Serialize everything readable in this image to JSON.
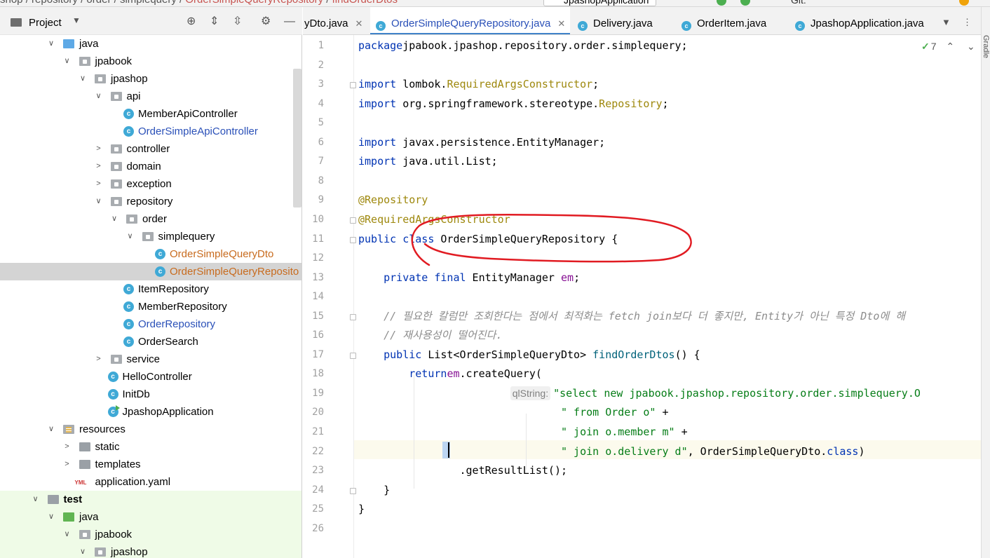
{
  "topbar": {
    "breadcrumb": [
      "shop",
      "repository",
      "order",
      "simplequery"
    ],
    "breadcrumb_class": "OrderSimpleQueryRepository",
    "breadcrumb_method": "findOrderDtos",
    "run_config": "JpashopApplication",
    "git_label": "Git:"
  },
  "project_panel": {
    "title": "Project",
    "toolbar_icons": [
      "locate-icon",
      "expand-all-icon",
      "collapse-all-icon",
      "gear-icon",
      "minimize-icon"
    ],
    "tree": [
      {
        "label": "java",
        "type": "src-folder",
        "indent": 0,
        "arrow": "open"
      },
      {
        "label": "jpabook",
        "type": "package",
        "indent": 1,
        "arrow": "open"
      },
      {
        "label": "jpashop",
        "type": "package",
        "indent": 2,
        "arrow": "open"
      },
      {
        "label": "api",
        "type": "package",
        "indent": 3,
        "arrow": "open"
      },
      {
        "label": "MemberApiController",
        "type": "class",
        "indent": 4,
        "arrow": "none",
        "style": "normal"
      },
      {
        "label": "OrderSimpleApiController",
        "type": "class",
        "indent": 4,
        "arrow": "none",
        "style": "blue"
      },
      {
        "label": "controller",
        "type": "package",
        "indent": 3,
        "arrow": "closed"
      },
      {
        "label": "domain",
        "type": "package",
        "indent": 3,
        "arrow": "closed"
      },
      {
        "label": "exception",
        "type": "package",
        "indent": 3,
        "arrow": "closed"
      },
      {
        "label": "repository",
        "type": "package",
        "indent": 3,
        "arrow": "open"
      },
      {
        "label": "order",
        "type": "package",
        "indent": 4,
        "arrow": "open"
      },
      {
        "label": "simplequery",
        "type": "package",
        "indent": 5,
        "arrow": "open"
      },
      {
        "label": "OrderSimpleQueryDto",
        "type": "class",
        "indent": 6,
        "arrow": "none",
        "style": "orange"
      },
      {
        "label": "OrderSimpleQueryReposito",
        "type": "class",
        "indent": 6,
        "arrow": "none",
        "style": "orange",
        "selected": true
      },
      {
        "label": "ItemRepository",
        "type": "class",
        "indent": 4,
        "arrow": "none",
        "style": "normal"
      },
      {
        "label": "MemberRepository",
        "type": "class",
        "indent": 4,
        "arrow": "none",
        "style": "normal"
      },
      {
        "label": "OrderRepository",
        "type": "class",
        "indent": 4,
        "arrow": "none",
        "style": "blue"
      },
      {
        "label": "OrderSearch",
        "type": "class",
        "indent": 4,
        "arrow": "none",
        "style": "normal"
      },
      {
        "label": "service",
        "type": "package",
        "indent": 3,
        "arrow": "closed"
      },
      {
        "label": "HelloController",
        "type": "class",
        "indent": 3,
        "arrow": "none",
        "style": "normal"
      },
      {
        "label": "InitDb",
        "type": "class",
        "indent": 3,
        "arrow": "none",
        "style": "normal"
      },
      {
        "label": "JpashopApplication",
        "type": "app-class",
        "indent": 3,
        "arrow": "none",
        "style": "normal"
      },
      {
        "label": "resources",
        "type": "res-folder",
        "indent": 0,
        "arrow": "open"
      },
      {
        "label": "static",
        "type": "gray-folder",
        "indent": 1,
        "arrow": "closed"
      },
      {
        "label": "templates",
        "type": "gray-folder",
        "indent": 1,
        "arrow": "closed"
      },
      {
        "label": "application.yaml",
        "type": "yaml",
        "indent": 1,
        "arrow": "none",
        "style": "normal"
      },
      {
        "label": "test",
        "type": "test-root",
        "indent": -1,
        "arrow": "open",
        "test": true
      },
      {
        "label": "java",
        "type": "test-folder",
        "indent": 0,
        "arrow": "open",
        "test": true
      },
      {
        "label": "jpabook",
        "type": "package",
        "indent": 1,
        "arrow": "open",
        "test": true
      },
      {
        "label": "jpashop",
        "type": "package",
        "indent": 2,
        "arrow": "open",
        "test": true
      }
    ]
  },
  "tabs": [
    {
      "label": "yDto.java",
      "close": "✕",
      "active": false,
      "icon": false
    },
    {
      "label": "OrderSimpleQueryRepository.java",
      "close": "✕",
      "active": true,
      "icon": true
    },
    {
      "label": "Delivery.java",
      "close": "",
      "active": false,
      "icon": true
    },
    {
      "label": "OrderItem.java",
      "close": "",
      "active": false,
      "icon": true
    },
    {
      "label": "JpashopApplication.java",
      "close": "",
      "active": false,
      "icon": true
    }
  ],
  "inspection": {
    "count": "7"
  },
  "right_strip_label": "Gradle",
  "code_lines": [
    [
      [
        "kw",
        "package"
      ],
      [
        "",
        "jpabook.jpashop.repository.order.simplequery;"
      ]
    ],
    [],
    [
      [
        "kw",
        "import"
      ],
      [
        "",
        " lombok."
      ],
      [
        "ann",
        "RequiredArgsConstructor"
      ],
      [
        "",
        ";"
      ]
    ],
    [
      [
        "kw",
        "import"
      ],
      [
        "",
        " org.springframework.stereotype."
      ],
      [
        "ann",
        "Repository"
      ],
      [
        "",
        ";"
      ]
    ],
    [],
    [
      [
        "kw",
        "import"
      ],
      [
        "",
        " javax.persistence.EntityManager;"
      ]
    ],
    [
      [
        "kw",
        "import"
      ],
      [
        "",
        " java.util.List;"
      ]
    ],
    [],
    [
      [
        "ann",
        "@Repository"
      ]
    ],
    [
      [
        "ann",
        "@RequiredArgsConstructor"
      ]
    ],
    [
      [
        "kw",
        "public class"
      ],
      [
        "",
        " OrderSimpleQueryRepository {"
      ]
    ],
    [],
    [
      [
        "",
        "    "
      ],
      [
        "kw",
        "private final"
      ],
      [
        "",
        " EntityManager "
      ],
      [
        "fld",
        "em"
      ],
      [
        "",
        ";"
      ]
    ],
    [],
    [
      [
        "cmt",
        "    // 필요한 칼럼만 조회한다는 점에서 최적화는 fetch join보다 더 좋지만, Entity가 아닌 특정 Dto에 해"
      ]
    ],
    [
      [
        "cmt",
        "    // 재사용성이 떨어진다."
      ]
    ],
    [
      [
        "",
        "    "
      ],
      [
        "kw",
        "public"
      ],
      [
        "",
        " List<OrderSimpleQueryDto> "
      ],
      [
        "fn",
        "findOrderDtos"
      ],
      [
        "",
        "() {"
      ]
    ],
    [
      [
        "",
        "        "
      ],
      [
        "kw",
        "return"
      ],
      [
        " ",
        ""
      ],
      [
        "fld",
        "em"
      ],
      [
        "",
        ".createQuery("
      ]
    ],
    [
      [
        "",
        "                        "
      ],
      [
        "hint",
        "qlString:"
      ],
      [
        "str",
        "\"select new jpabook.jpashop.repository.order.simplequery.O"
      ]
    ],
    [
      [
        "",
        "                                "
      ],
      [
        "str",
        "\" from Order o\""
      ],
      [
        "",
        " +"
      ]
    ],
    [
      [
        "",
        "                                "
      ],
      [
        "str",
        "\" join o.member m\""
      ],
      [
        "",
        " +"
      ]
    ],
    [
      [
        "",
        "                                "
      ],
      [
        "str",
        "\" join o.delivery d\""
      ],
      [
        "",
        ", OrderSimpleQueryDto."
      ],
      [
        "kw",
        "class"
      ],
      [
        "",
        ")"
      ]
    ],
    [
      [
        "",
        "                "
      ],
      [
        "",
        ".getResultList();"
      ]
    ],
    [
      [
        "",
        "    }"
      ]
    ],
    [
      [
        "",
        "}"
      ]
    ],
    []
  ]
}
